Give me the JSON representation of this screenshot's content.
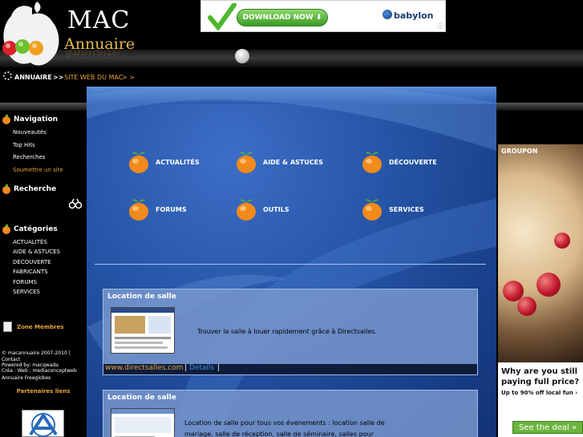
{
  "header": {
    "logo_main": "MAC",
    "logo_sub": "Annuaire"
  },
  "ad_banner": {
    "button_label": "DOWNLOAD NOW",
    "brand": "babylon"
  },
  "breadcrumb": {
    "home": "ANNUAIRE",
    "sep1": ">>",
    "current": "SITE WEB DU MAC",
    "sep2": "> >"
  },
  "sidebar": {
    "navigation": {
      "title": "Navigation",
      "items": [
        "Nouveautés",
        "Top Hits",
        "Recherches",
        "Soumettre un site"
      ]
    },
    "search": {
      "title": "Recherche"
    },
    "categories": {
      "title": "Catégories",
      "items": [
        "ACTUALITÉS",
        "AIDE & ASTUCES",
        "DÉCOUVERTE",
        "FABRICANTS",
        "FORUMS",
        "SERVICES"
      ]
    },
    "members": "Zone Membres",
    "footer": [
      "© macannuaire 2007-2010 |",
      "Contact",
      "Powered by: macqwada",
      "Créa : Web : mediaconceptweb",
      "Annuaire Freeglobes"
    ],
    "partners": "Partenaires liens"
  },
  "main": {
    "categories": [
      "ACTUALITÉS",
      "AIDE & ASTUCES",
      "DÉCOUVERTE",
      "FORUMS",
      "OUTILS",
      "SERVICES"
    ],
    "listings": [
      {
        "title": "Location de salle",
        "description": "Trouver la salle à louer rapidement grâce à Directsalles.",
        "url": "www.directsalles.com",
        "details": "Details"
      },
      {
        "title": "Location de salle",
        "description": "Location de salle pour tous vos évenements : location salle de mariage, salle de réception, salle de séminaire, salles pour"
      }
    ]
  },
  "right_ad": {
    "brand": "GROUPON",
    "headline": "Why are you still paying full price?",
    "sub": "Up to 90% off local fun ›",
    "button": "See the deal »"
  },
  "colors": {
    "accent": "#e8a33a",
    "main_bg": "#2656a8",
    "link_blue": "#4a8ee8"
  }
}
